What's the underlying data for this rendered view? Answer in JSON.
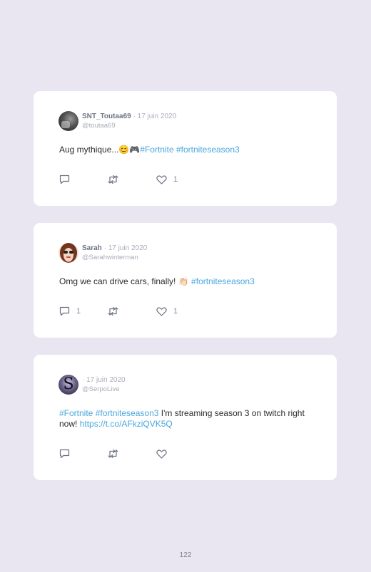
{
  "tweets": [
    {
      "username": "SNT_Toutaa69",
      "separator": "·",
      "date": "17 juin 2020",
      "handle": "@toutaa69",
      "text_before": "Aug mythique...",
      "emoji": "😊🎮",
      "hashtags": "#Fortnite #fortniteseason3",
      "reply_count": "",
      "retweet_count": "",
      "like_count": "1"
    },
    {
      "username": "Sarah",
      "separator": "·",
      "date": "17 juin 2020",
      "handle": "@Sarahwinterman",
      "text_before": "Omg we can drive cars, finally!",
      "emoji": "👏🏻",
      "hashtags": "#fortniteseason3",
      "reply_count": "1",
      "retweet_count": "",
      "like_count": "1"
    },
    {
      "username": "",
      "separator": "·",
      "date": "17 juin 2020",
      "handle": "@SerpoLive",
      "hashtags_lead": "#Fortnite #fortniteseason3",
      "text_middle": "I'm streaming season 3 on twitch right now!",
      "link": "https://t.co/AFkziQVK5Q",
      "reply_count": "",
      "retweet_count": "",
      "like_count": ""
    }
  ],
  "icons": {
    "reply": "reply-icon",
    "retweet": "retweet-icon",
    "like": "heart-icon"
  },
  "colors": {
    "background": "#e9e5f1",
    "card": "#ffffff",
    "hashtag": "#4aa7de",
    "username": "#6d7486",
    "meta": "#a8adb8"
  },
  "page_number": "122"
}
